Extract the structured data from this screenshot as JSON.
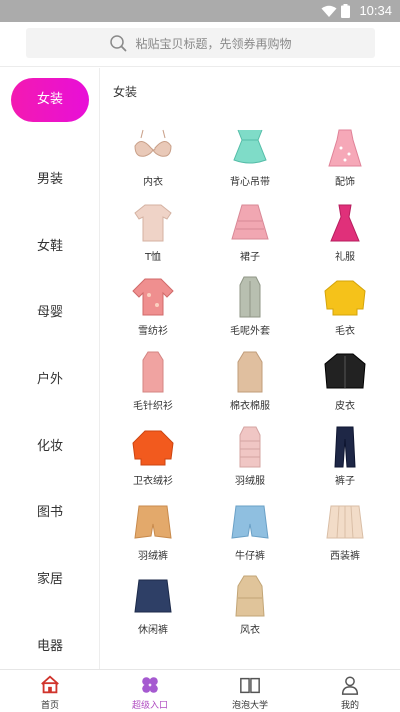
{
  "status_bar": {
    "time": "10:34"
  },
  "search": {
    "placeholder": "粘贴宝贝标题，先领券再购物"
  },
  "sidebar": {
    "items": [
      {
        "label": "女装",
        "active": true
      },
      {
        "label": "男装"
      },
      {
        "label": "女鞋"
      },
      {
        "label": "母婴"
      },
      {
        "label": "户外"
      },
      {
        "label": "化妆"
      },
      {
        "label": "图书"
      },
      {
        "label": "家居"
      },
      {
        "label": "电器"
      }
    ]
  },
  "content": {
    "title": "女装",
    "items": [
      {
        "label": "内衣",
        "icon": "bra-icon"
      },
      {
        "label": "背心吊带",
        "icon": "camisole-icon"
      },
      {
        "label": "配饰",
        "icon": "dress-accessory-icon"
      },
      {
        "label": "T恤",
        "icon": "tshirt-icon"
      },
      {
        "label": "裙子",
        "icon": "skirt-icon"
      },
      {
        "label": "礼服",
        "icon": "gown-icon"
      },
      {
        "label": "雪纺衫",
        "icon": "chiffon-shirt-icon"
      },
      {
        "label": "毛呢外套",
        "icon": "wool-coat-icon"
      },
      {
        "label": "毛衣",
        "icon": "sweater-icon"
      },
      {
        "label": "毛针织衫",
        "icon": "knit-top-icon"
      },
      {
        "label": "棉衣棉服",
        "icon": "cotton-coat-icon"
      },
      {
        "label": "皮衣",
        "icon": "leather-jacket-icon"
      },
      {
        "label": "卫衣绒衫",
        "icon": "hoodie-icon"
      },
      {
        "label": "羽绒服",
        "icon": "down-coat-icon"
      },
      {
        "label": "裤子",
        "icon": "pants-icon"
      },
      {
        "label": "羽绒裤",
        "icon": "down-shorts-icon"
      },
      {
        "label": "牛仔裤",
        "icon": "denim-shorts-icon"
      },
      {
        "label": "西装裤",
        "icon": "suit-shorts-icon"
      },
      {
        "label": "休闲裤",
        "icon": "casual-shorts-icon"
      },
      {
        "label": "风衣",
        "icon": "trench-coat-icon"
      }
    ]
  },
  "tabbar": {
    "tabs": [
      {
        "label": "首页",
        "icon": "home-icon"
      },
      {
        "label": "超级入口",
        "icon": "clover-icon",
        "active": true
      },
      {
        "label": "泡泡大学",
        "icon": "book-icon"
      },
      {
        "label": "我的",
        "icon": "person-icon"
      }
    ]
  },
  "colors": {
    "accent": "#ea12c8",
    "tab_active": "#b04dc2",
    "status_bar": "#ababab"
  }
}
